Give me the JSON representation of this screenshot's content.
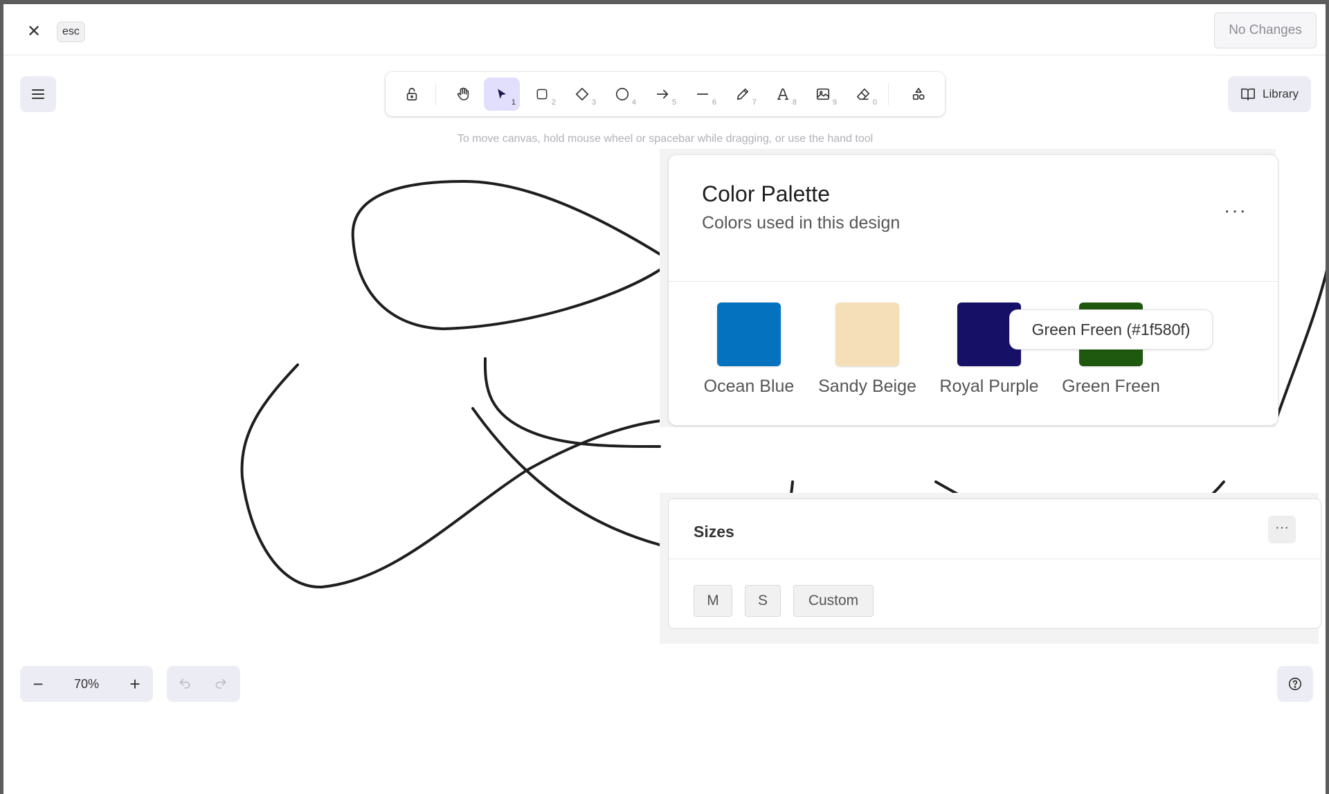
{
  "header": {
    "close_icon": "close-icon",
    "esc_label": "esc",
    "status_button": "No Changes"
  },
  "toolbar": {
    "tools": [
      {
        "name": "lock",
        "icon": "lock-icon",
        "shortcut": ""
      },
      {
        "name": "hand",
        "icon": "hand-icon",
        "shortcut": ""
      },
      {
        "name": "selection",
        "icon": "cursor-icon",
        "shortcut": "1",
        "active": true
      },
      {
        "name": "rectangle",
        "icon": "rectangle-icon",
        "shortcut": "2"
      },
      {
        "name": "diamond",
        "icon": "diamond-icon",
        "shortcut": "3"
      },
      {
        "name": "ellipse",
        "icon": "ellipse-icon",
        "shortcut": "4"
      },
      {
        "name": "arrow",
        "icon": "arrow-icon",
        "shortcut": "5"
      },
      {
        "name": "line",
        "icon": "line-icon",
        "shortcut": "6"
      },
      {
        "name": "draw",
        "icon": "pencil-icon",
        "shortcut": "7"
      },
      {
        "name": "text",
        "icon": "text-icon",
        "shortcut": "8"
      },
      {
        "name": "image",
        "icon": "image-icon",
        "shortcut": "9"
      },
      {
        "name": "eraser",
        "icon": "eraser-icon",
        "shortcut": "0"
      },
      {
        "name": "extra-tools",
        "icon": "shapes-icon",
        "shortcut": ""
      }
    ],
    "hint": "To move canvas, hold mouse wheel or spacebar while dragging, or use the hand tool"
  },
  "library": {
    "label": "Library"
  },
  "palette_card": {
    "title": "Color Palette",
    "subtitle": "Colors used in this design",
    "more": "···",
    "tooltip": "Green Freen (#1f580f)",
    "swatches": [
      {
        "name": "Ocean Blue",
        "color": "#0472bf"
      },
      {
        "name": "Sandy Beige",
        "color": "#f5dfb8"
      },
      {
        "name": "Royal Purple",
        "color": "#171067"
      },
      {
        "name": "Green Freen",
        "color": "#1f580f"
      }
    ]
  },
  "sizes_card": {
    "title": "Sizes",
    "more": "···",
    "options": [
      "M",
      "S",
      "Custom"
    ]
  },
  "footer": {
    "zoom_out": "−",
    "zoom_level": "70%",
    "zoom_in": "+"
  }
}
